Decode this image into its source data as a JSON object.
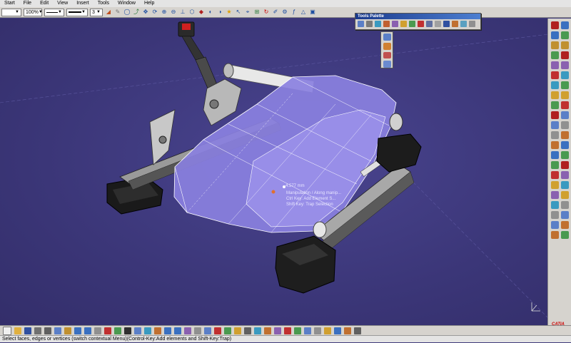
{
  "menu": {
    "items": [
      "Start",
      "File",
      "Edit",
      "View",
      "Insert",
      "Tools",
      "Window",
      "Help"
    ]
  },
  "toolbar": {
    "zoom_value": "100%",
    "layer_value": "3"
  },
  "palette": {
    "title": "Tools Palette"
  },
  "viewport": {
    "measure_label": "4.577 mm",
    "hint_lines": [
      "Manipulation / Along manip...",
      "Ctrl Key: Add Element S...",
      "Shift Key: Trap Selection"
    ]
  },
  "status": {
    "text": "Select faces, edges or vertices (switch contextual Menu)(Control-Key:Add elements and Shift-Key:Trap)"
  },
  "brand": {
    "label": "CATIA"
  },
  "colors": {
    "background": "#3f3a7a",
    "model_surface": "#8a80e0",
    "toolbar": "#d6d3ce"
  }
}
